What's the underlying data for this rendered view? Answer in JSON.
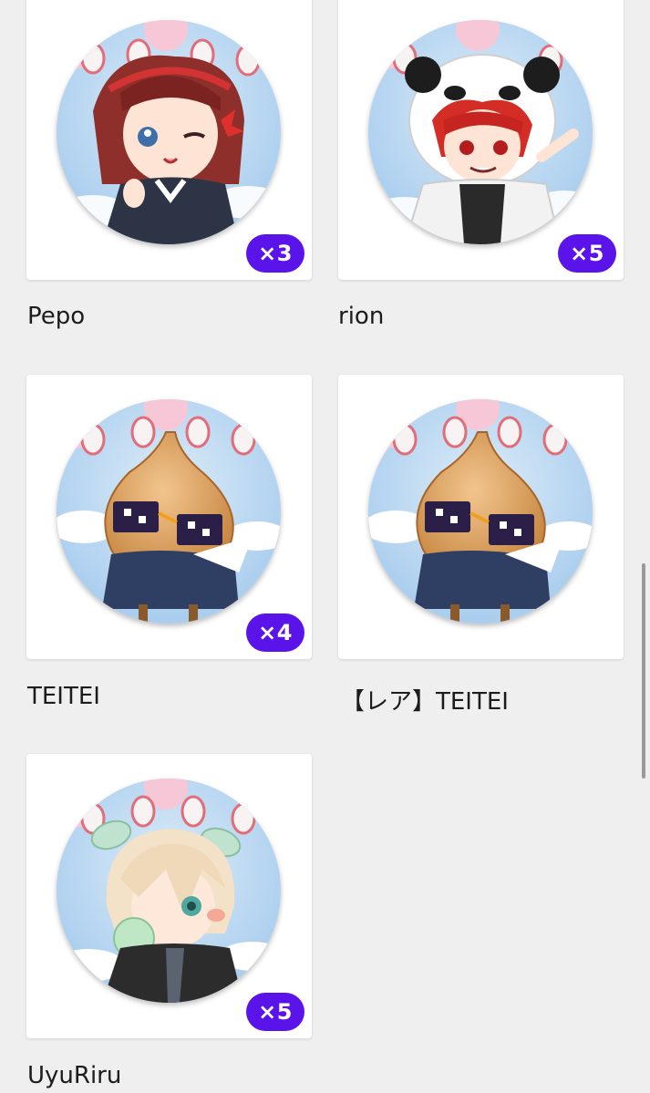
{
  "items": [
    {
      "name": "Pepo",
      "count": "×3",
      "character": "red-haired-girl"
    },
    {
      "name": "rion",
      "count": "×5",
      "character": "panda-hood-boy"
    },
    {
      "name": "TEITEI",
      "count": "×4",
      "character": "onion-with-sunglasses"
    },
    {
      "name": "【レア】TEITEI",
      "count": "",
      "character": "onion-with-sunglasses"
    },
    {
      "name": "UyuRiru",
      "count": "×5",
      "character": "blond-boy-bubblegum"
    }
  ],
  "colors": {
    "badge_count_bg": "#5a14ea",
    "page_bg": "#efefef",
    "card_bg": "#ffffff"
  }
}
